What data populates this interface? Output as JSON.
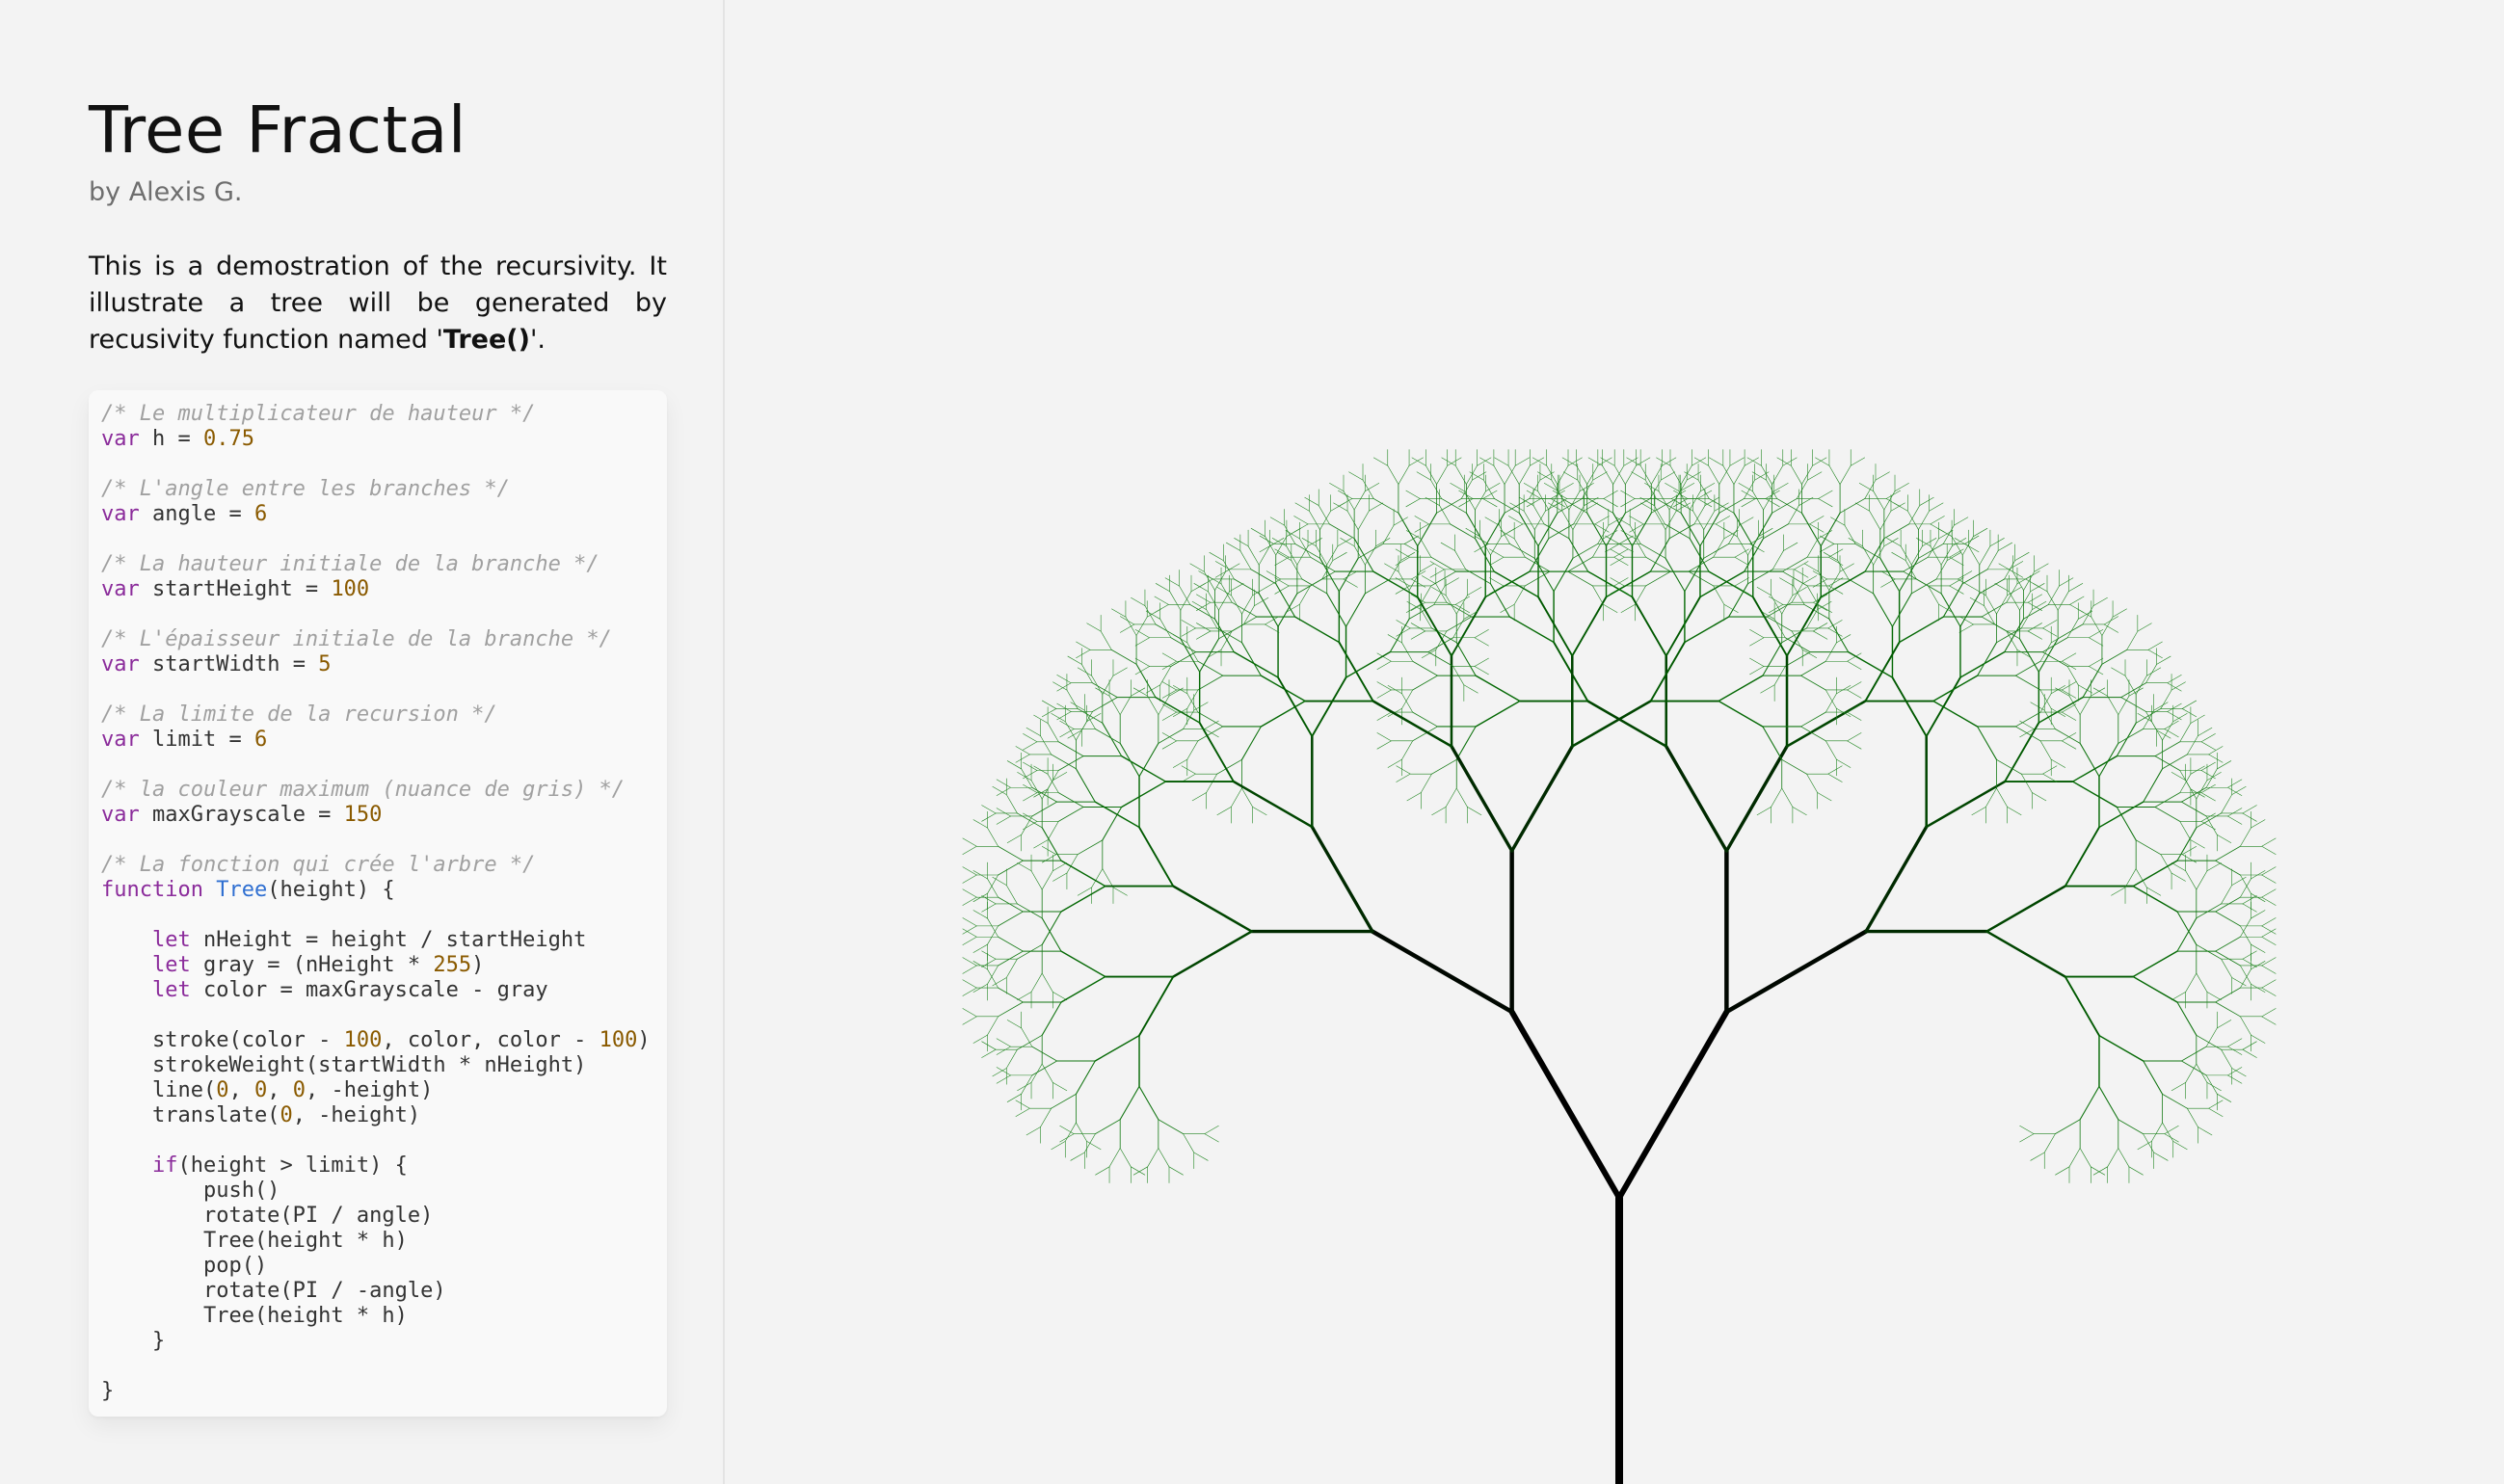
{
  "header": {
    "title": "Tree Fractal",
    "author": "by Alexis G."
  },
  "description": {
    "before": "This is a demostration of the recursivity. It illustrate a tree will be generated by recusivity function named '",
    "bold": "Tree()",
    "after": "'."
  },
  "code": {
    "lines": [
      {
        "t": [
          {
            "c": "c",
            "v": "/* Le multiplicateur de hauteur */"
          }
        ]
      },
      {
        "t": [
          {
            "c": "k",
            "v": "var"
          },
          {
            "c": "",
            "v": " h = "
          },
          {
            "c": "n",
            "v": "0.75"
          }
        ]
      },
      {
        "gap": true
      },
      {
        "t": [
          {
            "c": "c",
            "v": "/* L'angle entre les branches */"
          }
        ]
      },
      {
        "t": [
          {
            "c": "k",
            "v": "var"
          },
          {
            "c": "",
            "v": " angle = "
          },
          {
            "c": "n",
            "v": "6"
          }
        ]
      },
      {
        "gap": true
      },
      {
        "t": [
          {
            "c": "c",
            "v": "/* La hauteur initiale de la branche */"
          }
        ]
      },
      {
        "t": [
          {
            "c": "k",
            "v": "var"
          },
          {
            "c": "",
            "v": " startHeight = "
          },
          {
            "c": "n",
            "v": "100"
          }
        ]
      },
      {
        "gap": true
      },
      {
        "t": [
          {
            "c": "c",
            "v": "/* L'épaisseur initiale de la branche */"
          }
        ]
      },
      {
        "t": [
          {
            "c": "k",
            "v": "var"
          },
          {
            "c": "",
            "v": " startWidth = "
          },
          {
            "c": "n",
            "v": "5"
          }
        ]
      },
      {
        "gap": true
      },
      {
        "t": [
          {
            "c": "c",
            "v": "/* La limite de la recursion */"
          }
        ]
      },
      {
        "t": [
          {
            "c": "k",
            "v": "var"
          },
          {
            "c": "",
            "v": " limit = "
          },
          {
            "c": "n",
            "v": "6"
          }
        ]
      },
      {
        "gap": true
      },
      {
        "t": [
          {
            "c": "c",
            "v": "/* la couleur maximum (nuance de gris) */"
          }
        ]
      },
      {
        "t": [
          {
            "c": "k",
            "v": "var"
          },
          {
            "c": "",
            "v": " maxGrayscale = "
          },
          {
            "c": "n",
            "v": "150"
          }
        ]
      },
      {
        "gap": true
      },
      {
        "t": [
          {
            "c": "c",
            "v": "/* La fonction qui crée l'arbre */"
          }
        ]
      },
      {
        "t": [
          {
            "c": "k",
            "v": "function"
          },
          {
            "c": "",
            "v": " "
          },
          {
            "c": "f",
            "v": "Tree"
          },
          {
            "c": "",
            "v": "(height) {"
          }
        ]
      },
      {
        "gap": true
      },
      {
        "t": [
          {
            "c": "",
            "v": "    "
          },
          {
            "c": "k",
            "v": "let"
          },
          {
            "c": "",
            "v": " nHeight = height / startHeight"
          }
        ]
      },
      {
        "t": [
          {
            "c": "",
            "v": "    "
          },
          {
            "c": "k",
            "v": "let"
          },
          {
            "c": "",
            "v": " gray = (nHeight * "
          },
          {
            "c": "n",
            "v": "255"
          },
          {
            "c": "",
            "v": ")"
          }
        ]
      },
      {
        "t": [
          {
            "c": "",
            "v": "    "
          },
          {
            "c": "k",
            "v": "let"
          },
          {
            "c": "",
            "v": " color = maxGrayscale - gray"
          }
        ]
      },
      {
        "gap": true
      },
      {
        "t": [
          {
            "c": "",
            "v": "    stroke(color - "
          },
          {
            "c": "n",
            "v": "100"
          },
          {
            "c": "",
            "v": ", color, color - "
          },
          {
            "c": "n",
            "v": "100"
          },
          {
            "c": "",
            "v": ")"
          }
        ]
      },
      {
        "t": [
          {
            "c": "",
            "v": "    strokeWeight(startWidth * nHeight)"
          }
        ]
      },
      {
        "t": [
          {
            "c": "",
            "v": "    line("
          },
          {
            "c": "n",
            "v": "0"
          },
          {
            "c": "",
            "v": ", "
          },
          {
            "c": "n",
            "v": "0"
          },
          {
            "c": "",
            "v": ", "
          },
          {
            "c": "n",
            "v": "0"
          },
          {
            "c": "",
            "v": ", -height)"
          }
        ]
      },
      {
        "t": [
          {
            "c": "",
            "v": "    translate("
          },
          {
            "c": "n",
            "v": "0"
          },
          {
            "c": "",
            "v": ", -height)"
          }
        ]
      },
      {
        "gap": true
      },
      {
        "t": [
          {
            "c": "",
            "v": "    "
          },
          {
            "c": "k",
            "v": "if"
          },
          {
            "c": "",
            "v": "(height > limit) {"
          }
        ]
      },
      {
        "t": [
          {
            "c": "",
            "v": "        push()"
          }
        ]
      },
      {
        "t": [
          {
            "c": "",
            "v": "        rotate(PI / angle)"
          }
        ]
      },
      {
        "t": [
          {
            "c": "",
            "v": "        Tree(height * h)"
          }
        ]
      },
      {
        "t": [
          {
            "c": "",
            "v": "        pop()"
          }
        ]
      },
      {
        "t": [
          {
            "c": "",
            "v": "        rotate(PI / -angle)"
          }
        ]
      },
      {
        "t": [
          {
            "c": "",
            "v": "        Tree(height * h)"
          }
        ]
      },
      {
        "t": [
          {
            "c": "",
            "v": "    }"
          }
        ]
      },
      {
        "gap": true
      },
      {
        "t": [
          {
            "c": "",
            "v": "}"
          }
        ]
      }
    ]
  },
  "tree": {
    "h": 0.75,
    "angle": 6,
    "startHeight": 100,
    "startWidth": 5,
    "limit": 6,
    "maxGrayscale": 150
  },
  "colors": {
    "background": "#f3f3f3",
    "comment": "#a0a0a0",
    "keyword": "#8b2c9b",
    "number": "#8a5a00",
    "function": "#2f6fd1"
  }
}
